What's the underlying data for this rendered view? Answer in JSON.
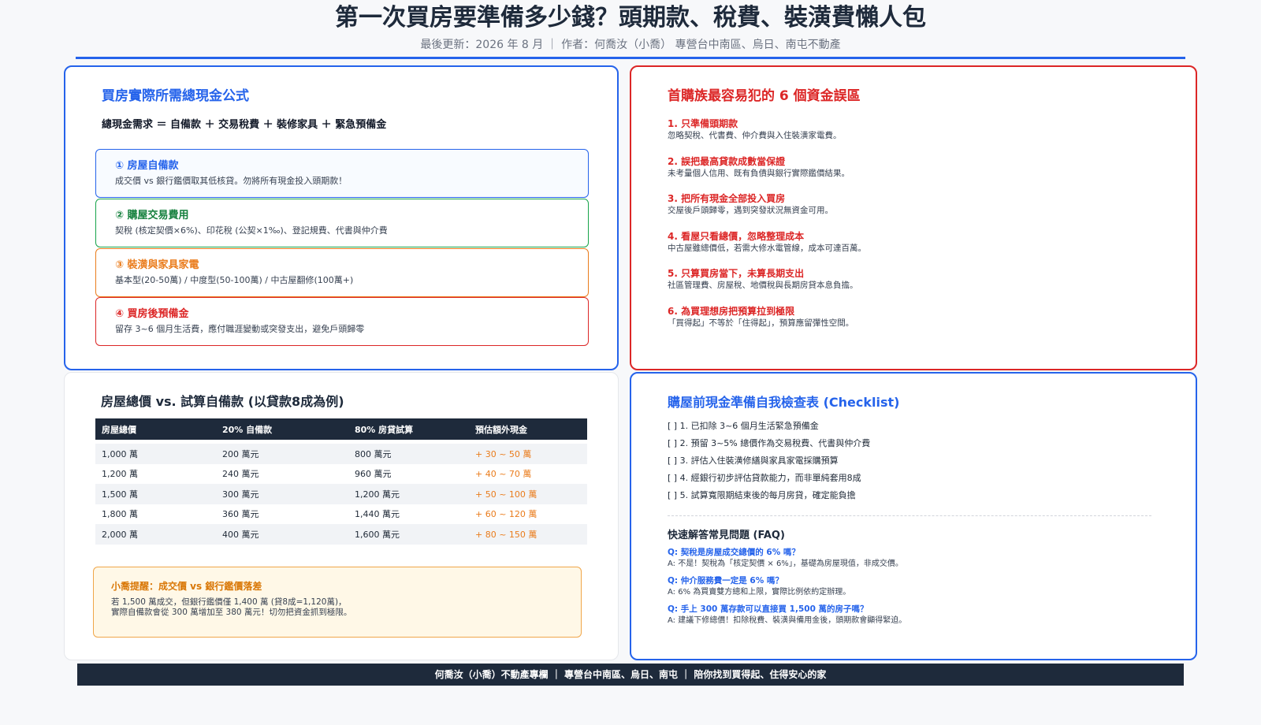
{
  "header": {
    "title": "第一次買房要準備多少錢？頭期款、稅費、裝潢費懶人包",
    "subtitle": "最後更新：2026 年 8 月 ｜ 作者：何喬汝（小喬） 專營台中南區、烏日、南屯不動產"
  },
  "formula_card": {
    "heading": "買房實際所需總現金公式",
    "formula": "總現金需求 ＝ 自備款 ＋ 交易稅費 ＋ 裝修家具 ＋ 緊急預備金",
    "steps": [
      {
        "title": "① 房屋自備款",
        "desc": "成交價 vs 銀行鑑價取其低核貸。勿將所有現金投入頭期款！"
      },
      {
        "title": "② 購屋交易費用",
        "desc": "契稅 (核定契價×6%)、印花稅 (公契×1‰)、登記規費、代書與仲介費"
      },
      {
        "title": "③ 裝潢與家具家電",
        "desc": "基本型(20-50萬) / 中度型(50-100萬) / 中古屋翻修(100萬+)"
      },
      {
        "title": "④ 買房後預備金",
        "desc": "留存 3~6 個月生活費，應付職涯變動或突發支出，避免戶頭歸零"
      }
    ]
  },
  "mistakes_card": {
    "heading": "首購族最容易犯的 6 個資金誤區",
    "items": [
      {
        "title": "1. 只準備頭期款",
        "desc": "忽略契稅、代書費、仲介費與入住裝潢家電費。"
      },
      {
        "title": "2. 誤把最高貸款成數當保證",
        "desc": "未考量個人信用、既有負債與銀行實際鑑價結果。"
      },
      {
        "title": "3. 把所有現金全部投入買房",
        "desc": "交屋後戶頭歸零，遇到突發狀況無資金可用。"
      },
      {
        "title": "4. 看屋只看總價，忽略整理成本",
        "desc": "中古屋雖總價低，若需大修水電管線，成本可達百萬。"
      },
      {
        "title": "5. 只算買房當下，未算長期支出",
        "desc": "社區管理費、房屋稅、地價稅與長期房貸本息負擔。"
      },
      {
        "title": "6. 為買理想房把預算拉到極限",
        "desc": "「買得起」不等於「住得起」，預算應留彈性空間。"
      }
    ]
  },
  "table_card": {
    "heading": "房屋總價 vs. 試算自備款 (以貸款8成為例)",
    "columns": [
      "房屋總價",
      "20% 自備款",
      "80% 房貸試算",
      "預估額外現金"
    ],
    "rows": [
      [
        "1,000 萬",
        "200 萬元",
        "800 萬元",
        "+ 30 ~ 50 萬"
      ],
      [
        "1,200 萬",
        "240 萬元",
        "960 萬元",
        "+ 40 ~ 70 萬"
      ],
      [
        "1,500 萬",
        "300 萬元",
        "1,200 萬元",
        "+ 50 ~ 100 萬"
      ],
      [
        "1,800 萬",
        "360 萬元",
        "1,440 萬元",
        "+ 60 ~ 120 萬"
      ],
      [
        "2,000 萬",
        "400 萬元",
        "1,600 萬元",
        "+ 80 ~ 150 萬"
      ]
    ],
    "tip": {
      "title": "小喬提醒：成交價 vs 銀行鑑價落差",
      "line1": "若 1,500 萬成交，但銀行鑑價僅 1,400 萬 (貸8成=1,120萬)，",
      "line2": "實際自備款會從 300 萬增加至 380 萬元！切勿把資金抓到極限。"
    }
  },
  "checklist_card": {
    "heading": "購屋前現金準備自我檢查表 (Checklist)",
    "items": [
      "[ ] 1. 已扣除 3~6 個月生活緊急預備金",
      "[ ] 2. 預留 3~5% 總價作為交易稅費、代書與仲介費",
      "[ ] 3. 評估入住裝潢修繕與家具家電採購預算",
      "[ ] 4. 經銀行初步評估貸款能力，而非單純套用8成",
      "[ ] 5. 試算寬限期結束後的每月房貸，確定能負擔"
    ],
    "faq_heading": "快速解答常見問題 (FAQ)",
    "faq": [
      {
        "q": "Q: 契稅是房屋成交總價的 6% 嗎？",
        "a": "A: 不是！契稅為「核定契價 × 6%」，基礎為房屋現值，非成交價。"
      },
      {
        "q": "Q: 仲介服務費一定是 6% 嗎？",
        "a": "A: 6% 為買賣雙方總和上限，實際比例依約定辦理。"
      },
      {
        "q": "Q: 手上 300 萬存款可以直接買 1,500 萬的房子嗎？",
        "a": "A: 建議下修總價！扣除稅費、裝潢與備用金後，頭期款會顯得緊迫。"
      }
    ]
  },
  "footer": {
    "text": "何喬汝（小喬）不動產專欄 ｜ 專營台中南區、烏日、南屯 ｜ 陪你找到買得起、住得安心的家"
  }
}
